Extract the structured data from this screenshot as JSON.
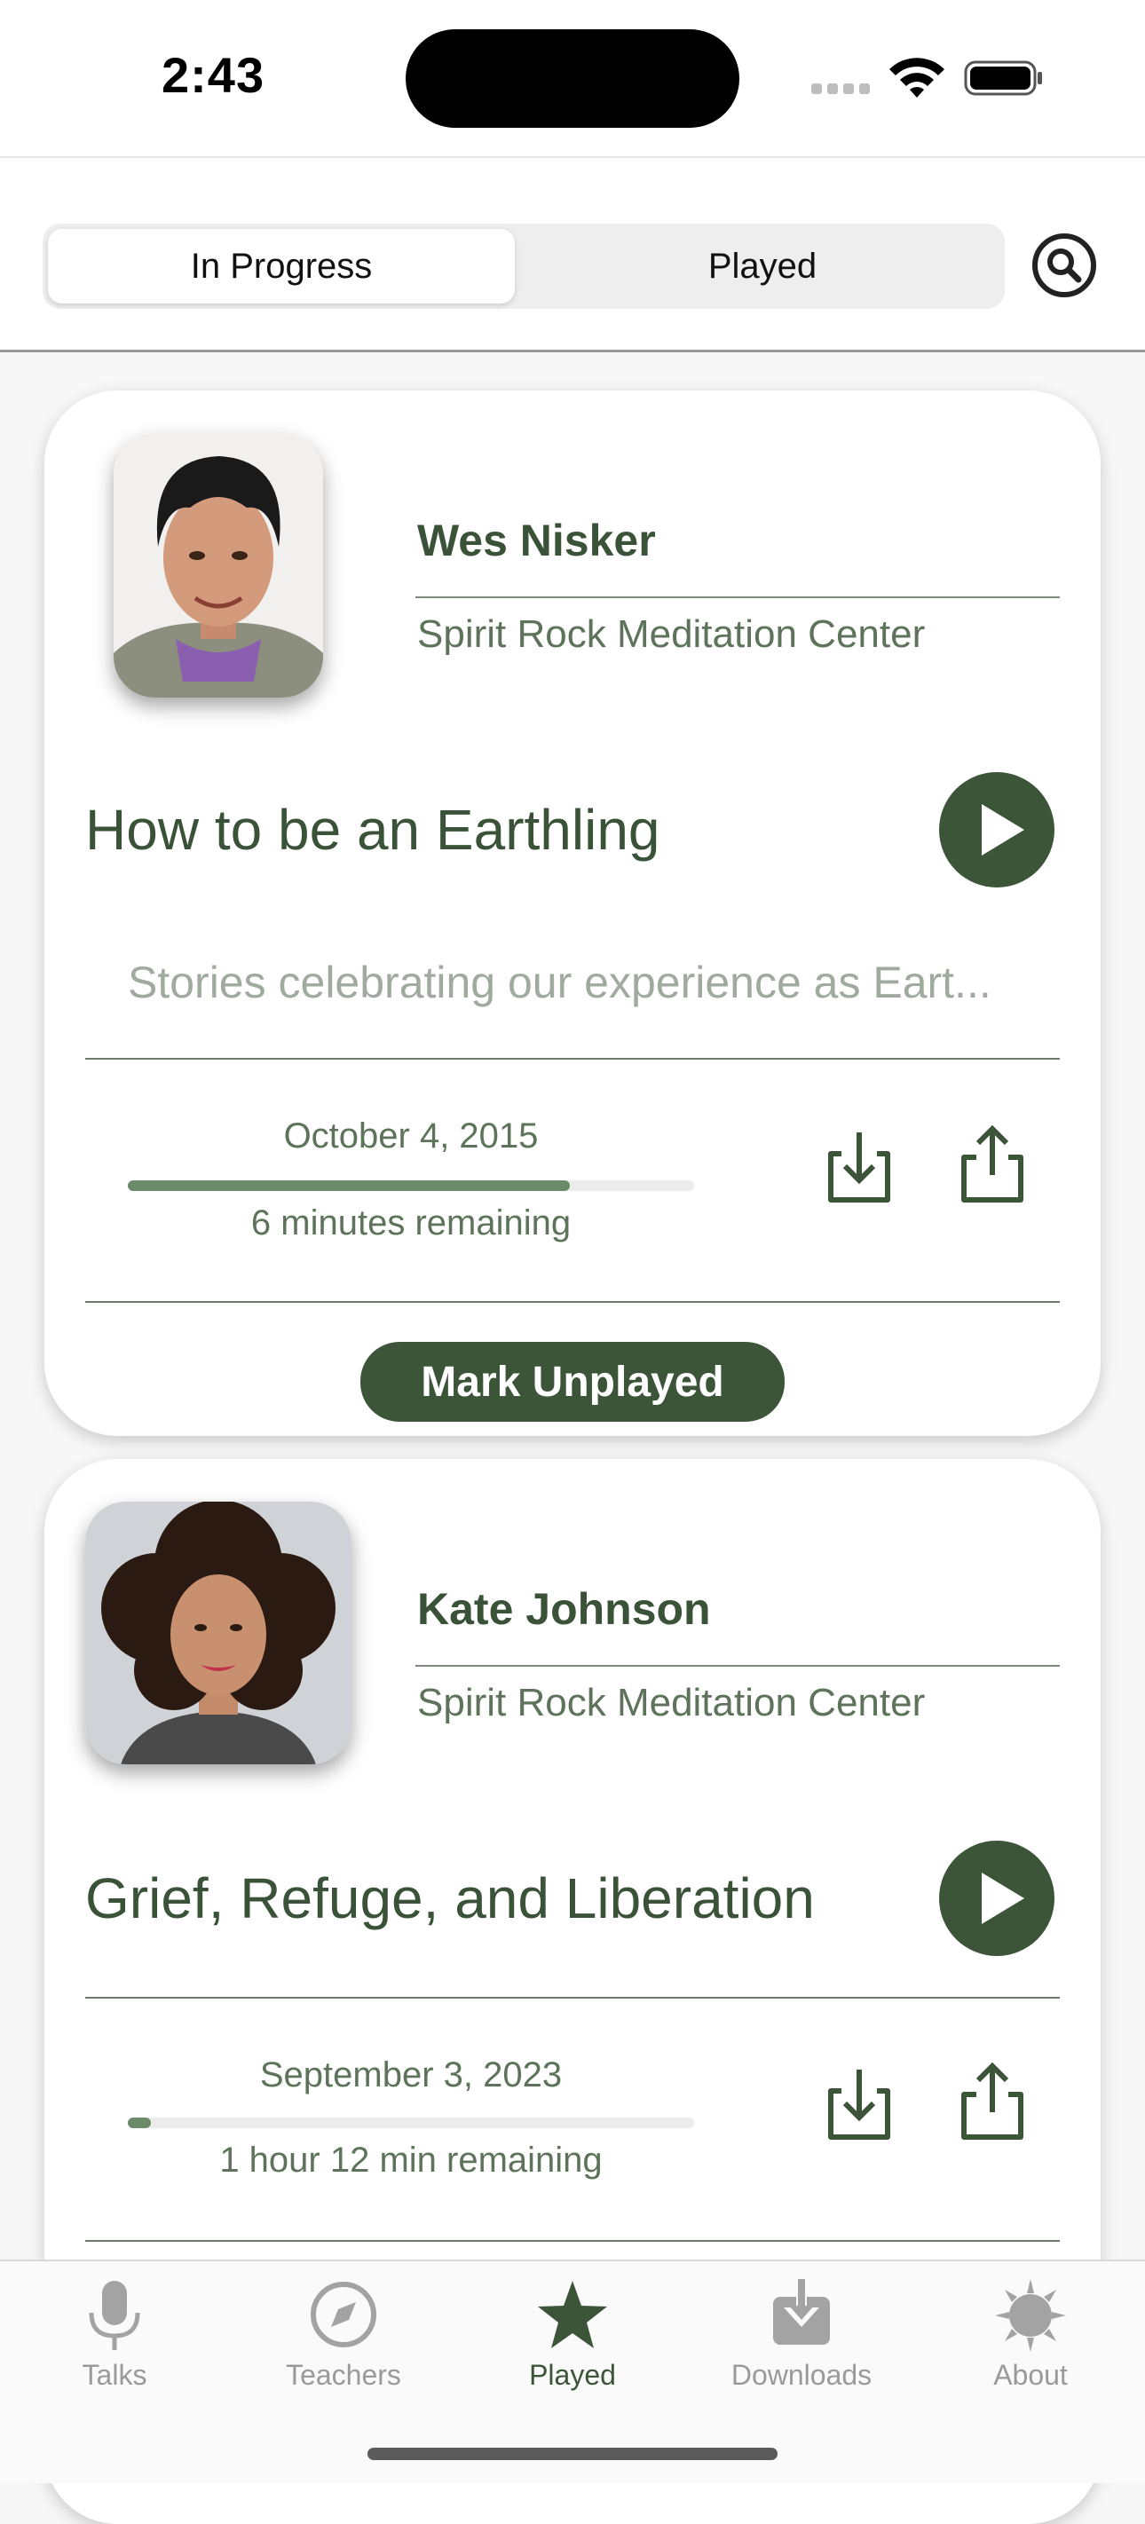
{
  "status_bar": {
    "time": "2:43"
  },
  "segmented": {
    "tabs": [
      {
        "label": "In Progress",
        "selected": true
      },
      {
        "label": "Played",
        "selected": false
      }
    ]
  },
  "search": {
    "icon": "search-icon"
  },
  "cards": [
    {
      "teacher": "Wes Nisker",
      "center": "Spirit Rock Meditation Center",
      "title": "How to be an Earthling",
      "description": "Stories celebrating our experience as Eart...",
      "date": "October 4, 2015",
      "progress": 0.78,
      "remaining": "6 minutes remaining",
      "mark_label": "Mark Unplayed"
    },
    {
      "teacher": "Kate Johnson",
      "center": "Spirit Rock Meditation Center",
      "title": "Grief, Refuge, and Liberation",
      "date": "September 3, 2023",
      "progress": 0.04,
      "remaining": "1 hour 12 min remaining"
    }
  ],
  "tabbar": {
    "items": [
      {
        "label": "Talks",
        "icon": "microphone-icon"
      },
      {
        "label": "Teachers",
        "icon": "compass-icon"
      },
      {
        "label": "Played",
        "icon": "star-icon",
        "active": true
      },
      {
        "label": "Downloads",
        "icon": "download-tray-icon"
      },
      {
        "label": "About",
        "icon": "sun-icon"
      }
    ]
  },
  "colors": {
    "accent": "#3c5539",
    "text": "#3a5238",
    "muted": "#5d745b",
    "progress": "#6a8a68"
  }
}
